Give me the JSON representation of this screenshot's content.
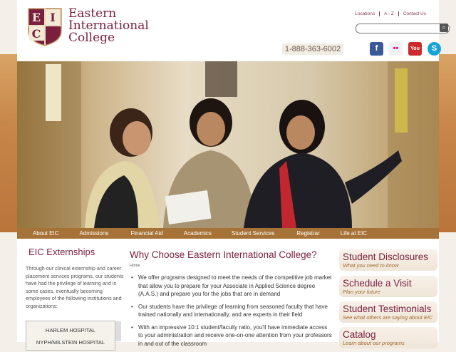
{
  "brand": {
    "letters": [
      "E",
      "I",
      "C"
    ],
    "name_line1": "Eastern",
    "name_line2": "International",
    "name_line3": "College"
  },
  "top_links": [
    "Locations",
    "A - Z",
    "Contact Us"
  ],
  "search": {
    "placeholder": ""
  },
  "phone": "1-888-363-6002",
  "social": [
    {
      "name": "facebook-icon",
      "label": "f",
      "color": "#3b5998"
    },
    {
      "name": "flickr-icon",
      "label": "••",
      "color": "#f0f0f0"
    },
    {
      "name": "youtube-icon",
      "label": "You",
      "color": "#cc2b2b"
    },
    {
      "name": "skype-icon",
      "label": "S",
      "color": "#17a3d8"
    }
  ],
  "nav": [
    "About EIC",
    "Admissions",
    "Financial Aid",
    "Academics",
    "Student Services",
    "Registrar",
    "Life at EIC"
  ],
  "externships": {
    "title": "EIC Externships",
    "text": "Through our clinical externship and career placement services programs, our students have had the privilege of learning and in some cases, eventually becoming employees of the following institutions and organizations:",
    "list": [
      "HARLEM HOSPITAL",
      "NYPH/MILSTEIN HOSPITAL"
    ]
  },
  "main": {
    "title": "Why Choose Eastern International College?",
    "breadcrumb": "Home",
    "bullets": [
      "We offer programs designed to meet the needs of the competitive job market that allow you to prepare for your Associate in Applied Science degree (A.A.S.) and prepare you for the jobs that are in demand",
      "Our students have the privilege of learning from seasoned faculty that have trained nationally and internationally, and are experts in their field",
      "With an impressive 10:1 student/faculty ratio, you'll have immediate access to your administration and receive one-on-one attention from your professors in and out of the classroom"
    ]
  },
  "cards": [
    {
      "title": "Student Disclosures",
      "sub": "What you need to know"
    },
    {
      "title": "Schedule a Visit",
      "sub": "Plan your future"
    },
    {
      "title": "Student Testimonials",
      "sub": "See what others are saying about EIC"
    },
    {
      "title": "Catalog",
      "sub": "Learn about our programs"
    }
  ],
  "colors": {
    "maroon": "#7a1f3d",
    "gold": "#a77237"
  }
}
